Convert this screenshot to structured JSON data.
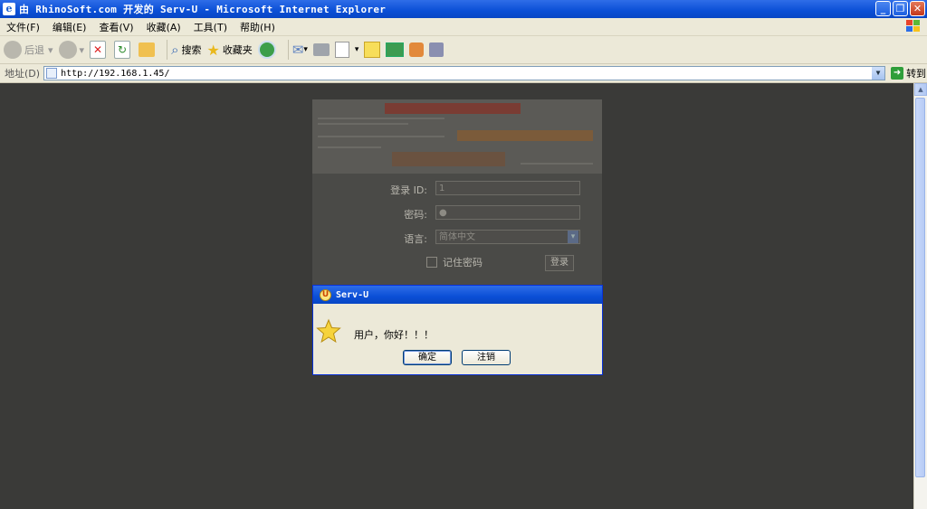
{
  "window": {
    "title": "由 RhinoSoft.com 开发的 Serv-U - Microsoft Internet Explorer",
    "buttons": {
      "minimize": "_",
      "restore": "❐",
      "close": "✕"
    }
  },
  "menu": [
    "文件(F)",
    "编辑(E)",
    "查看(V)",
    "收藏(A)",
    "工具(T)",
    "帮助(H)"
  ],
  "toolbar": {
    "back": "后退",
    "search": "搜索",
    "favorites": "收藏夹"
  },
  "address": {
    "label": "地址(D)",
    "url": "http://192.168.1.45/",
    "go": "转到"
  },
  "login_form": {
    "login_id_label": "登录 ID:",
    "login_id_value": "1",
    "password_label": "密码:",
    "password_value": "●",
    "language_label": "语言:",
    "language_value": "简体中文",
    "remember_label": "记住密码",
    "login_button": "登录"
  },
  "dialog": {
    "title": "Serv-U",
    "message": "用户，你好！！！",
    "ok": "确定",
    "cancel": "注销"
  },
  "colors": {
    "titlebar": "#0a4fd6",
    "chrome": "#ece9d8",
    "overlay": "#3a3a38"
  }
}
